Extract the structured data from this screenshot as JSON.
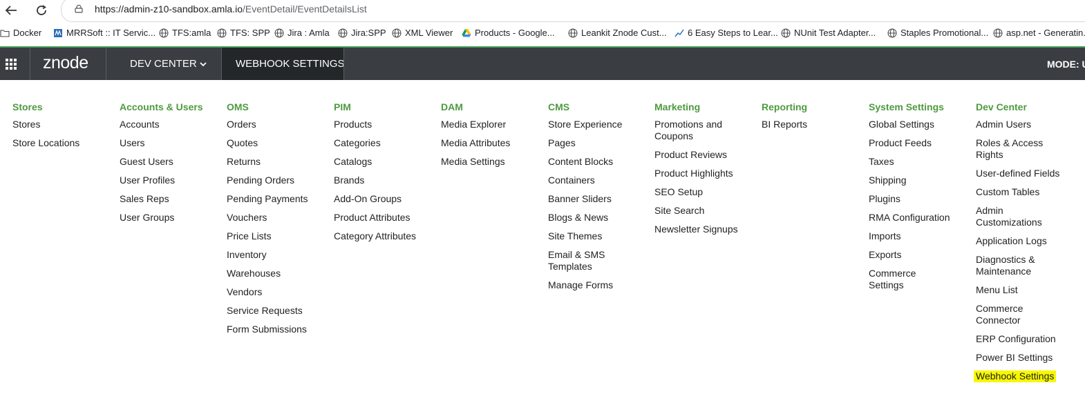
{
  "browser": {
    "url_host": "https://admin-z10-sandbox.amla.io",
    "url_path": "/EventDetail/EventDetailsList",
    "bookmarks": [
      {
        "label": "Docker",
        "icon": "folder-icon"
      },
      {
        "label": "MRRSoft :: IT Servic...",
        "icon": "mrrsoft-icon"
      },
      {
        "label": "TFS:amla",
        "icon": "globe-icon"
      },
      {
        "label": "TFS: SPP",
        "icon": "globe-icon"
      },
      {
        "label": "Jira : Amla",
        "icon": "globe-icon"
      },
      {
        "label": "Jira:SPP",
        "icon": "globe-icon"
      },
      {
        "label": "XML Viewer",
        "icon": "globe-icon"
      },
      {
        "label": "Products - Google...",
        "icon": "google-drive-icon"
      },
      {
        "label": "Leankit Znode Cust...",
        "icon": "globe-icon"
      },
      {
        "label": "6 Easy Steps to Lear...",
        "icon": "trend-icon"
      },
      {
        "label": "NUnit Test Adapter...",
        "icon": "globe-icon"
      },
      {
        "label": "Staples Promotional...",
        "icon": "globe-icon"
      },
      {
        "label": "asp.net - Generatin...",
        "icon": "globe-icon"
      }
    ]
  },
  "header": {
    "logo": "znode",
    "dev_center": "DEV CENTER",
    "active_tab": "WEBHOOK SETTINGS",
    "mode": "MODE: UA"
  },
  "menu": {
    "columns": [
      {
        "title": "Stores",
        "items": [
          "Stores",
          "Store Locations"
        ]
      },
      {
        "title": "Accounts & Users",
        "items": [
          "Accounts",
          "Users",
          "Guest Users",
          "User Profiles",
          "Sales Reps",
          "User Groups"
        ]
      },
      {
        "title": "OMS",
        "items": [
          "Orders",
          "Quotes",
          "Returns",
          "Pending Orders",
          "Pending Payments",
          "Vouchers",
          "Price Lists",
          "Inventory",
          "Warehouses",
          "Vendors",
          "Service Requests",
          "Form Submissions"
        ]
      },
      {
        "title": "PIM",
        "items": [
          "Products",
          "Categories",
          "Catalogs",
          "Brands",
          "Add-On Groups",
          "Product Attributes",
          "Category Attributes"
        ]
      },
      {
        "title": "DAM",
        "items": [
          "Media Explorer",
          "Media Attributes",
          "Media Settings"
        ]
      },
      {
        "title": "CMS",
        "items": [
          "Store Experience",
          "Pages",
          "Content Blocks",
          "Containers",
          "Banner Sliders",
          "Blogs & News",
          "Site Themes",
          "Email & SMS Templates",
          "Manage Forms"
        ]
      },
      {
        "title": "Marketing",
        "items": [
          "Promotions and Coupons",
          "Product Reviews",
          "Product Highlights",
          "SEO Setup",
          "Site Search",
          "Newsletter Signups"
        ]
      },
      {
        "title": "Reporting",
        "items": [
          "BI Reports"
        ]
      },
      {
        "title": "System Settings",
        "items": [
          "Global Settings",
          "Product Feeds",
          "Taxes",
          "Shipping",
          "Plugins",
          "RMA Configuration",
          "Imports",
          "Exports",
          "Commerce Settings"
        ]
      },
      {
        "title": "Dev Center",
        "items": [
          "Admin Users",
          "Roles & Access Rights",
          "User-defined Fields",
          "Custom Tables",
          "Admin Customizations",
          "Application Logs",
          "Diagnostics & Maintenance",
          "Menu List",
          "Commerce Connector",
          "ERP Configuration",
          "Power BI Settings",
          "Webhook Settings"
        ]
      }
    ],
    "highlighted_item": "Webhook Settings",
    "colors": {
      "heading": "#4e9a3f",
      "highlight": "#f7f700",
      "header_bg": "#3a3e42"
    }
  }
}
